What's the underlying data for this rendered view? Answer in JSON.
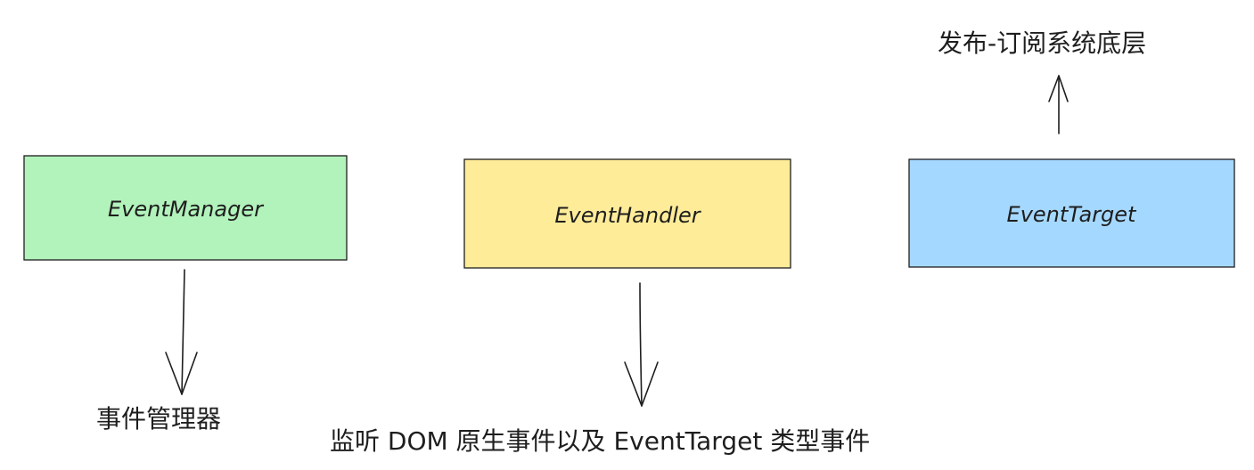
{
  "nodes": [
    {
      "id": "manager",
      "label": "EventManager",
      "fill": "#b2f2bb"
    },
    {
      "id": "handler",
      "label": "EventHandler",
      "fill": "#ffec99"
    },
    {
      "id": "target",
      "label": "EventTarget",
      "fill": "#a5d8ff"
    }
  ],
  "notes": {
    "manager": "事件管理器",
    "handler": "监听 DOM 原生事件以及 EventTarget 类型事件",
    "target": "发布-订阅系统底层"
  }
}
